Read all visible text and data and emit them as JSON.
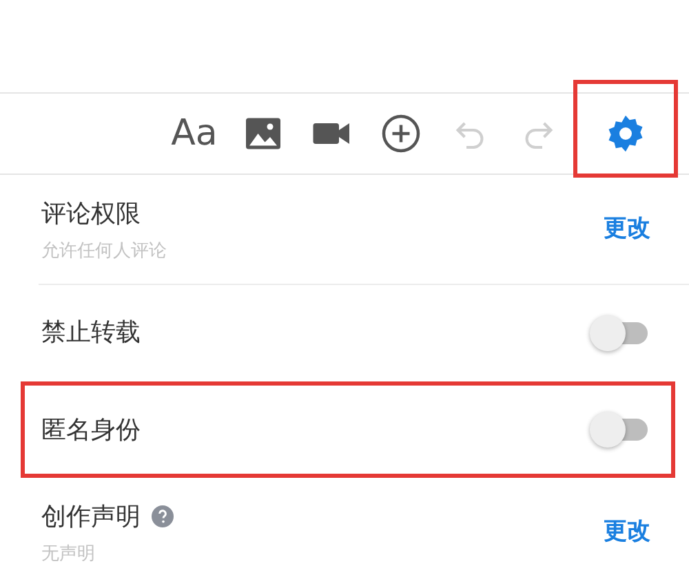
{
  "toolbar": {
    "tools": [
      {
        "kind": "text",
        "label": "Aa",
        "disabled": false,
        "active": false
      },
      {
        "kind": "image",
        "disabled": false,
        "active": false
      },
      {
        "kind": "video",
        "disabled": false,
        "active": false
      },
      {
        "kind": "add",
        "disabled": false,
        "active": false
      },
      {
        "kind": "undo",
        "disabled": true,
        "active": false
      },
      {
        "kind": "redo",
        "disabled": true,
        "active": false
      },
      {
        "kind": "settings",
        "disabled": false,
        "active": true,
        "highlighted": true
      }
    ]
  },
  "settings": [
    {
      "kind": "link",
      "title": "评论权限",
      "subtitle": "允许任何人评论",
      "action": "更改"
    },
    {
      "kind": "toggle",
      "title": "禁止转载",
      "on": false
    },
    {
      "kind": "toggle",
      "title": "匿名身份",
      "on": false,
      "highlighted": true
    },
    {
      "kind": "link",
      "title": "创作声明",
      "help": true,
      "subtitle": "无声明",
      "action": "更改"
    }
  ]
}
